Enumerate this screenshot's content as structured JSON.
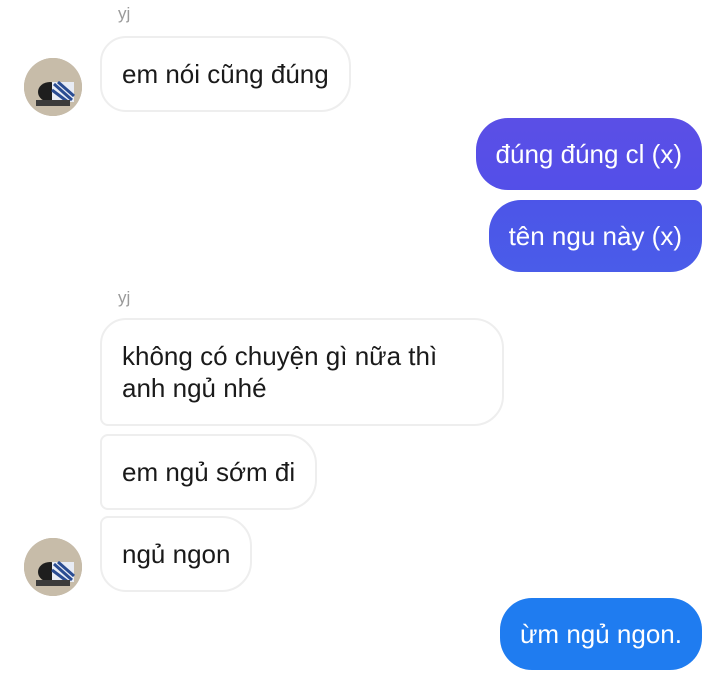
{
  "colors": {
    "out_gradient_top": "#5b4fe6",
    "out_gradient_mid": "#4c55e8",
    "out_blue": "#1f7cf0",
    "incoming_border": "#eeeeee",
    "sender_name": "#9a9a9a"
  },
  "groups": [
    {
      "sender": "yj"
    },
    {
      "sender": "yj"
    }
  ],
  "messages": [
    {
      "text": "em nói cũng đúng"
    },
    {
      "text": "đúng đúng cl (x)"
    },
    {
      "text": "tên ngu này (x)"
    },
    {
      "line1": "không có chuyện gì nữa thì",
      "line2": "anh ngủ nhé"
    },
    {
      "text": "em ngủ sớm đi"
    },
    {
      "text": "ngủ ngon"
    },
    {
      "text": "ừm ngủ ngon."
    }
  ],
  "avatar_icon": "user-avatar-icon"
}
